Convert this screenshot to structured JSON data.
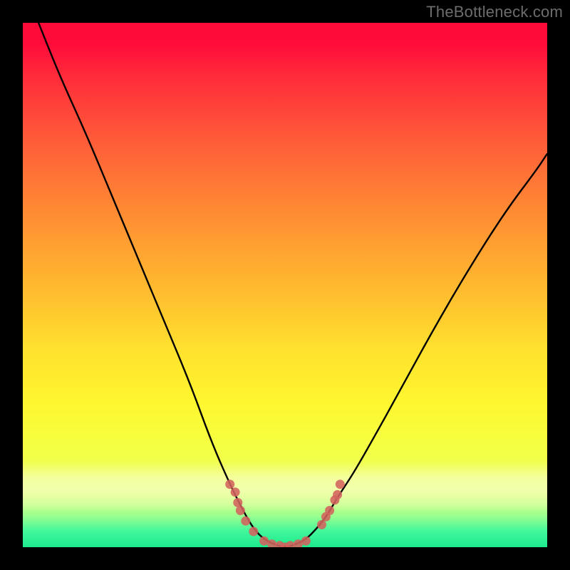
{
  "watermark": "TheBottleneck.com",
  "chart_data": {
    "type": "line",
    "title": "",
    "xlabel": "",
    "ylabel": "",
    "xlim": [
      0,
      100
    ],
    "ylim": [
      0,
      100
    ],
    "grid": false,
    "legend_position": "none",
    "series": [
      {
        "name": "bottleneck-curve",
        "x": [
          3,
          7,
          12,
          17,
          22,
          27,
          32,
          36,
          39.5,
          42,
          44,
          46,
          48,
          50,
          52,
          54,
          56,
          58,
          60,
          63,
          67,
          72,
          78,
          85,
          92,
          98,
          100
        ],
        "y": [
          100,
          90,
          79,
          67,
          55,
          43,
          31,
          20,
          12,
          7,
          3.5,
          1.5,
          0.5,
          0,
          0.5,
          1.5,
          3.5,
          6,
          9.5,
          14,
          21,
          30,
          41,
          53,
          64,
          72,
          75
        ],
        "color": "#000000"
      }
    ],
    "marker_points": {
      "name": "highlighted-markers",
      "color": "#d3625d",
      "points": [
        {
          "x": 39.5,
          "y": 12
        },
        {
          "x": 40.5,
          "y": 10.5
        },
        {
          "x": 41,
          "y": 8.5
        },
        {
          "x": 41.5,
          "y": 7
        },
        {
          "x": 42.5,
          "y": 5
        },
        {
          "x": 44,
          "y": 3
        },
        {
          "x": 46,
          "y": 1.2
        },
        {
          "x": 47.5,
          "y": 0.6
        },
        {
          "x": 49,
          "y": 0.3
        },
        {
          "x": 50,
          "y": 0
        },
        {
          "x": 51,
          "y": 0.3
        },
        {
          "x": 52.5,
          "y": 0.6
        },
        {
          "x": 54,
          "y": 1.2
        },
        {
          "x": 57,
          "y": 4.3
        },
        {
          "x": 57.8,
          "y": 5.8
        },
        {
          "x": 58.5,
          "y": 7
        },
        {
          "x": 59.5,
          "y": 9
        },
        {
          "x": 60,
          "y": 10
        },
        {
          "x": 60.5,
          "y": 12
        }
      ]
    },
    "background_gradient": {
      "top_color": "#ff0b3a",
      "mid_color": "#ffe02e",
      "bottom_color": "#1de98d"
    }
  }
}
